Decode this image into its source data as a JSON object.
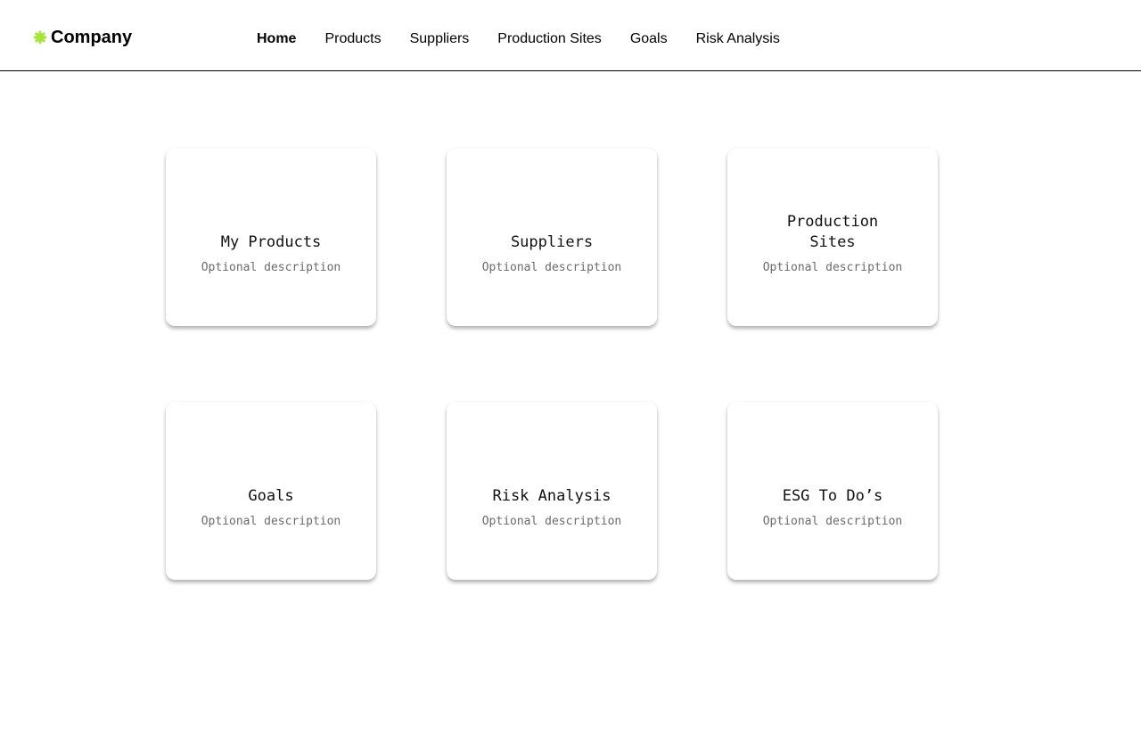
{
  "brand": {
    "name": "Company",
    "icon": "gear-icon",
    "icon_color": "#a3e635"
  },
  "nav": {
    "items": [
      {
        "label": "Home",
        "active": true
      },
      {
        "label": "Products",
        "active": false
      },
      {
        "label": "Suppliers",
        "active": false
      },
      {
        "label": "Production Sites",
        "active": false
      },
      {
        "label": "Goals",
        "active": false
      },
      {
        "label": "Risk Analysis",
        "active": false
      }
    ]
  },
  "cards": [
    {
      "title": "My Products",
      "description": "Optional description"
    },
    {
      "title": "Suppliers",
      "description": "Optional description"
    },
    {
      "title": "Production Sites",
      "description": "Optional description"
    },
    {
      "title": "Goals",
      "description": "Optional description"
    },
    {
      "title": "Risk Analysis",
      "description": "Optional description"
    },
    {
      "title": "ESG To Do’s",
      "description": "Optional description"
    }
  ]
}
